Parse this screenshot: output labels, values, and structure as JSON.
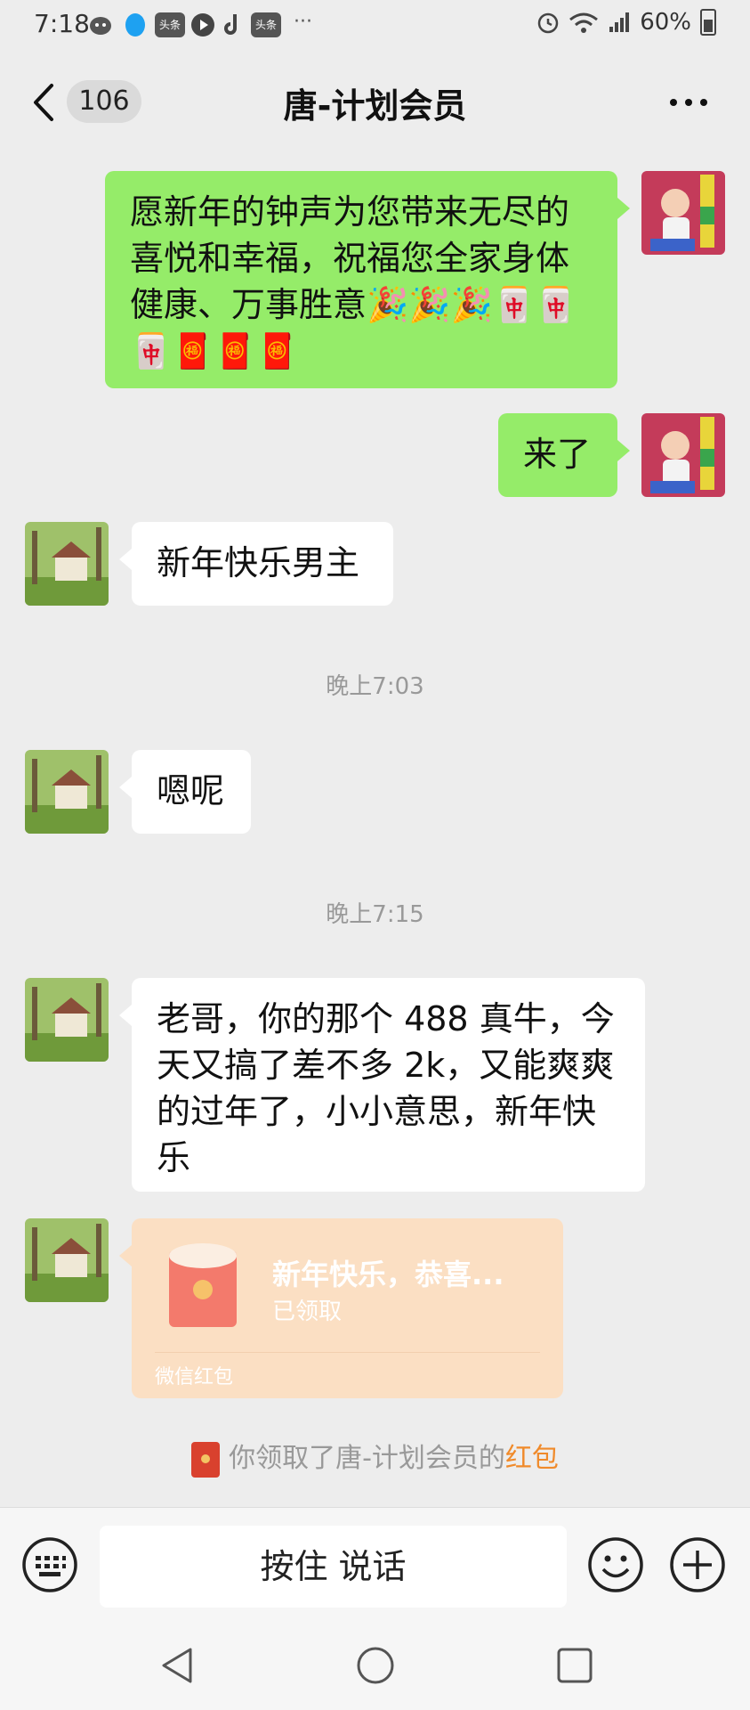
{
  "status_bar": {
    "time": "7:18",
    "app_badges": [
      "头条",
      "头条"
    ],
    "more": "···",
    "battery": "60%"
  },
  "header": {
    "unread_count": "106",
    "title": "唐-计划会员"
  },
  "messages": [
    {
      "side": "me",
      "text": "愿新年的钟声为您带来无尽的喜悦和幸福，祝福您全家身体健康、万事胜意🎉🎉🎉🀄🀄🀄🧧🧧🧧"
    },
    {
      "side": "me",
      "text": "来了"
    },
    {
      "side": "other",
      "text": "新年快乐男主"
    },
    {
      "side": "other",
      "text": "嗯呢"
    },
    {
      "side": "other",
      "text": "老哥，你的那个 488 真牛，今天又搞了差不多 2k，又能爽爽的过年了，小小意思，新年快乐"
    }
  ],
  "timestamps": [
    "晚上7:03",
    "晚上7:15"
  ],
  "red_envelope": {
    "title": "新年快乐，恭喜...",
    "status": "已领取",
    "footer": "微信红包"
  },
  "system_message": {
    "prefix": "你领取了唐-计划会员的",
    "link": "红包"
  },
  "input_bar": {
    "voice_label": "按住 说话"
  },
  "colors": {
    "my_bubble": "#95ec69",
    "their_bubble": "#ffffff",
    "envelope": "#fbdfc3",
    "link": "#f08a2a"
  }
}
